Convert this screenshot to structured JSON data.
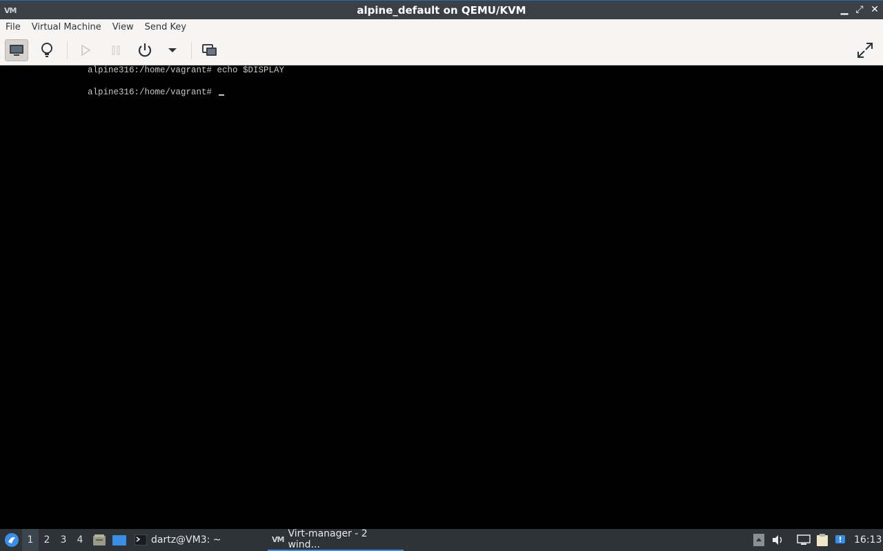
{
  "window": {
    "title": "alpine_default on QEMU/KVM",
    "app_icon_text": "VM",
    "minimize_glyph": "▁",
    "maximize_glyph": "⤢",
    "close_glyph": "✕"
  },
  "menubar": {
    "items": [
      "File",
      "Virtual Machine",
      "View",
      "Send Key"
    ]
  },
  "toolbar": {
    "buttons": [
      {
        "icon": "monitor-icon",
        "active": true
      },
      {
        "icon": "lightbulb-icon",
        "active": false
      },
      {
        "icon": "play-icon",
        "active": false,
        "disabled": true
      },
      {
        "icon": "pause-icon",
        "active": false,
        "disabled": true
      },
      {
        "icon": "power-icon",
        "active": false
      },
      {
        "icon": "dropdown-arrow-icon",
        "active": false
      },
      {
        "icon": "snapshots-icon",
        "active": false
      },
      {
        "icon": "fullscreen-icon",
        "active": false
      }
    ]
  },
  "console": {
    "lines": [
      "alpine316:/home/vagrant# echo $DISPLAY",
      "alpine316:/home/vagrant# "
    ]
  },
  "taskbar": {
    "workspaces": [
      "1",
      "2",
      "3",
      "4"
    ],
    "active_workspace": "1",
    "tasks": [
      {
        "label": "dartz@VM3: ~",
        "icon": "terminal-icon"
      },
      {
        "label": "Virt-manager - 2 wind...",
        "icon": "virt-manager-icon",
        "active": true
      }
    ],
    "clock": "16:13",
    "colors": {
      "background": "#2d3338",
      "accent": "#3a8ee6"
    }
  }
}
